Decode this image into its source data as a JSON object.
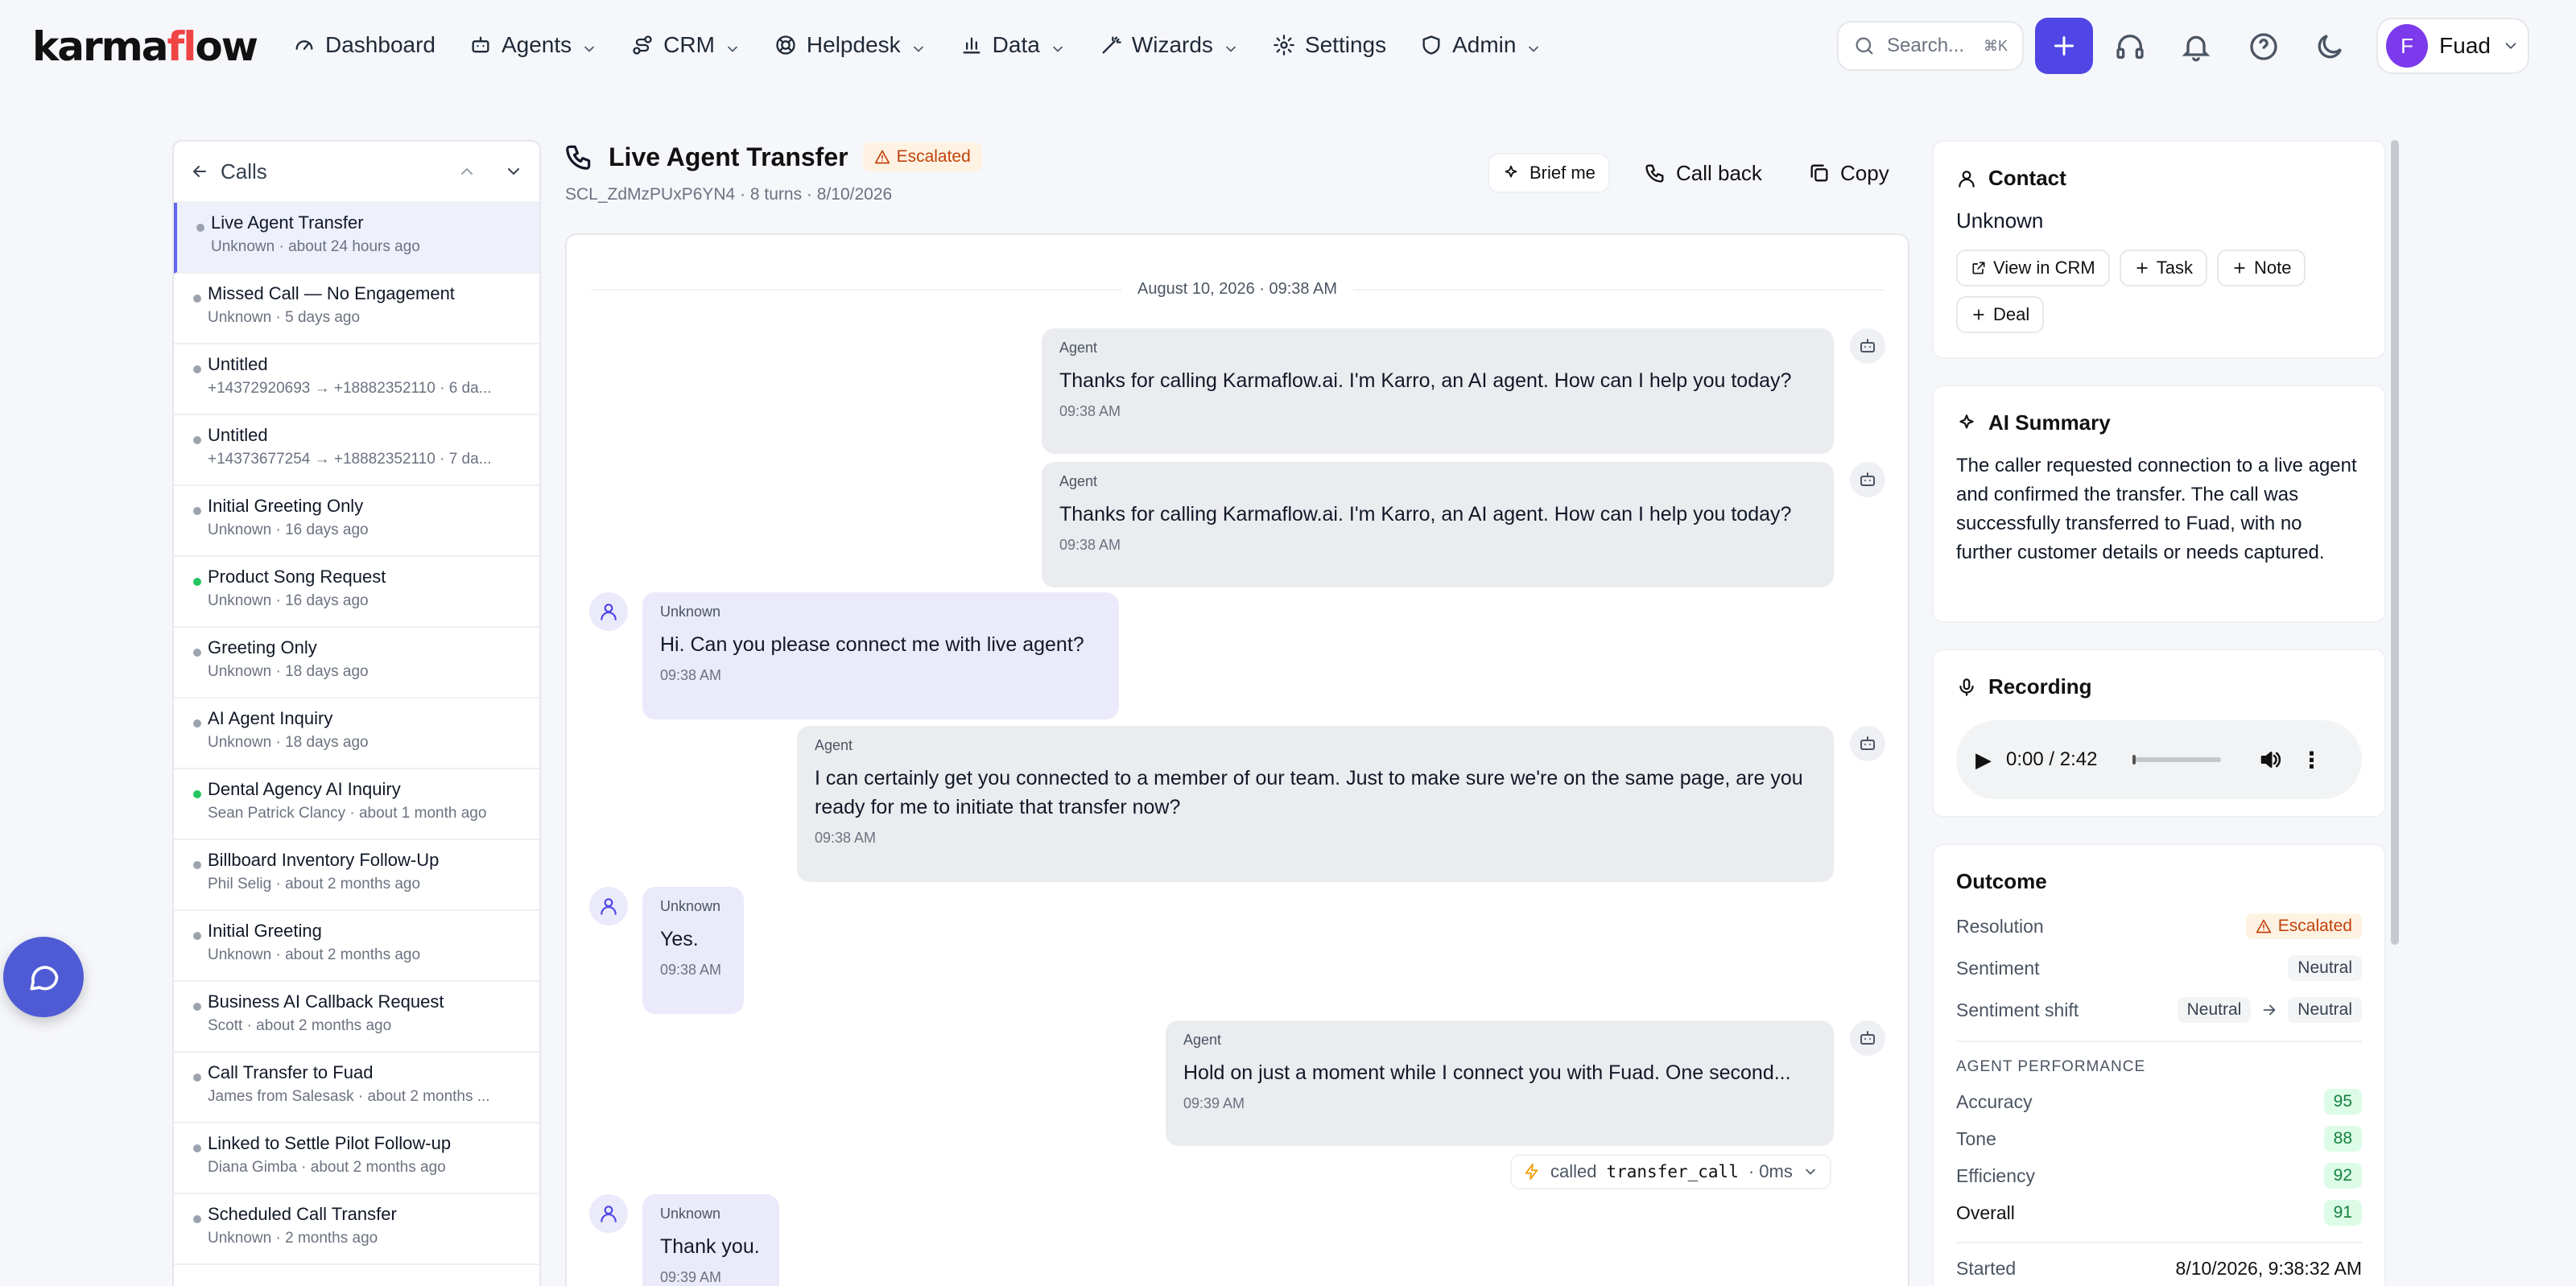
{
  "brand": {
    "pre": "karma",
    "fl": "fl",
    "post": "ow",
    "accent": "#ef4444"
  },
  "nav": [
    {
      "label": "Dashboard",
      "icon": "gauge-icon",
      "chev": false
    },
    {
      "label": "Agents",
      "icon": "bot-icon",
      "chev": true
    },
    {
      "label": "CRM",
      "icon": "route-icon",
      "chev": true
    },
    {
      "label": "Helpdesk",
      "icon": "lifebuoy-icon",
      "chev": true
    },
    {
      "label": "Data",
      "icon": "bar-chart-icon",
      "chev": true
    },
    {
      "label": "Wizards",
      "icon": "wand-icon",
      "chev": true
    },
    {
      "label": "Settings",
      "icon": "gear-icon",
      "chev": false
    },
    {
      "label": "Admin",
      "icon": "shield-icon",
      "chev": true
    }
  ],
  "search": {
    "placeholder": "Search...",
    "shortcut": "⌘K"
  },
  "user": {
    "initial": "F",
    "name": "Fuad"
  },
  "calls": {
    "title": "Calls",
    "items": [
      {
        "title": "Live Agent Transfer",
        "sub": "Unknown · about 24 hours ago",
        "dot": "gray",
        "active": true
      },
      {
        "title": "Missed Call — No Engagement",
        "sub": "Unknown · 5 days ago",
        "dot": "gray"
      },
      {
        "title": "Untitled",
        "sub": "+14372920693 → +18882352110 · 6 da...",
        "dot": "gray"
      },
      {
        "title": "Untitled",
        "sub": "+14373677254 → +18882352110 · 7 da...",
        "dot": "gray"
      },
      {
        "title": "Initial Greeting Only",
        "sub": "Unknown · 16 days ago",
        "dot": "gray"
      },
      {
        "title": "Product Song Request",
        "sub": "Unknown · 16 days ago",
        "dot": "green"
      },
      {
        "title": "Greeting Only",
        "sub": "Unknown · 18 days ago",
        "dot": "gray"
      },
      {
        "title": "AI Agent Inquiry",
        "sub": "Unknown · 18 days ago",
        "dot": "gray"
      },
      {
        "title": "Dental Agency AI Inquiry",
        "sub": "Sean Patrick Clancy · about 1 month ago",
        "dot": "green"
      },
      {
        "title": "Billboard Inventory Follow-Up",
        "sub": "Phil Selig · about 2 months ago",
        "dot": "gray"
      },
      {
        "title": "Initial Greeting",
        "sub": "Unknown · about 2 months ago",
        "dot": "gray"
      },
      {
        "title": "Business AI Callback Request",
        "sub": "Scott · about 2 months ago",
        "dot": "gray"
      },
      {
        "title": "Call Transfer to Fuad",
        "sub": "James from Salesask · about 2 months ...",
        "dot": "gray"
      },
      {
        "title": "Linked to Settle Pilot Follow-up",
        "sub": "Diana Gimba · about 2 months ago",
        "dot": "gray"
      },
      {
        "title": "Scheduled Call Transfer",
        "sub": "Unknown · 2 months ago",
        "dot": "gray"
      }
    ]
  },
  "call": {
    "title": "Live Agent Transfer",
    "status": "Escalated",
    "meta": "SCL_ZdMzPUxP6YN4 · 8 turns · 8/10/2026",
    "actions": {
      "brief": "Brief me",
      "callback": "Call back",
      "copy": "Copy"
    },
    "date": "August 10, 2026 · 09:38 AM",
    "tool": {
      "prefix": "called",
      "name": "transfer_call",
      "suffix": "· 0ms"
    },
    "messages": [
      {
        "who": "Agent",
        "text": "Thanks for calling Karmaflow.ai. I'm Karro, an AI agent. How can I help you today?",
        "time": "09:38 AM"
      },
      {
        "who": "Agent",
        "text": "Thanks for calling Karmaflow.ai. I'm Karro, an AI agent. How can I help you today?",
        "time": "09:38 AM"
      },
      {
        "who": "Unknown",
        "text": "Hi. Can you please connect me with live agent?",
        "time": "09:38 AM"
      },
      {
        "who": "Agent",
        "text": "I can certainly get you connected to a member of our team. Just to make sure we're on the same page, are you ready for me to initiate that transfer now?",
        "time": "09:38 AM"
      },
      {
        "who": "Unknown",
        "text": "Yes.",
        "time": "09:38 AM"
      },
      {
        "who": "Agent",
        "text": "Hold on just a moment while I connect you with Fuad. One second...",
        "time": "09:39 AM"
      },
      {
        "who": "Unknown",
        "text": "Thank you.",
        "time": "09:39 AM"
      }
    ]
  },
  "contact": {
    "title": "Contact",
    "name": "Unknown",
    "actions": {
      "crm": "View in CRM",
      "task": "Task",
      "note": "Note",
      "deal": "Deal"
    }
  },
  "summary": {
    "title": "AI Summary",
    "text": "The caller requested connection to a live agent and confirmed the transfer. The call was successfully transferred to Fuad, with no further customer details or needs captured."
  },
  "recording": {
    "title": "Recording",
    "time": "0:00 / 2:42",
    "progress": 0
  },
  "outcome": {
    "title": "Outcome",
    "resolution_label": "Resolution",
    "resolution": "Escalated",
    "sentiment_label": "Sentiment",
    "sentiment": "Neutral",
    "shift_label": "Sentiment shift",
    "shift_from": "Neutral",
    "shift_to": "Neutral",
    "perf_title": "AGENT PERFORMANCE",
    "metrics": [
      {
        "label": "Accuracy",
        "value": "95"
      },
      {
        "label": "Tone",
        "value": "88"
      },
      {
        "label": "Efficiency",
        "value": "92"
      },
      {
        "label": "Overall",
        "value": "91"
      }
    ],
    "started_label": "Started",
    "started": "8/10/2026, 9:38:32 AM"
  }
}
